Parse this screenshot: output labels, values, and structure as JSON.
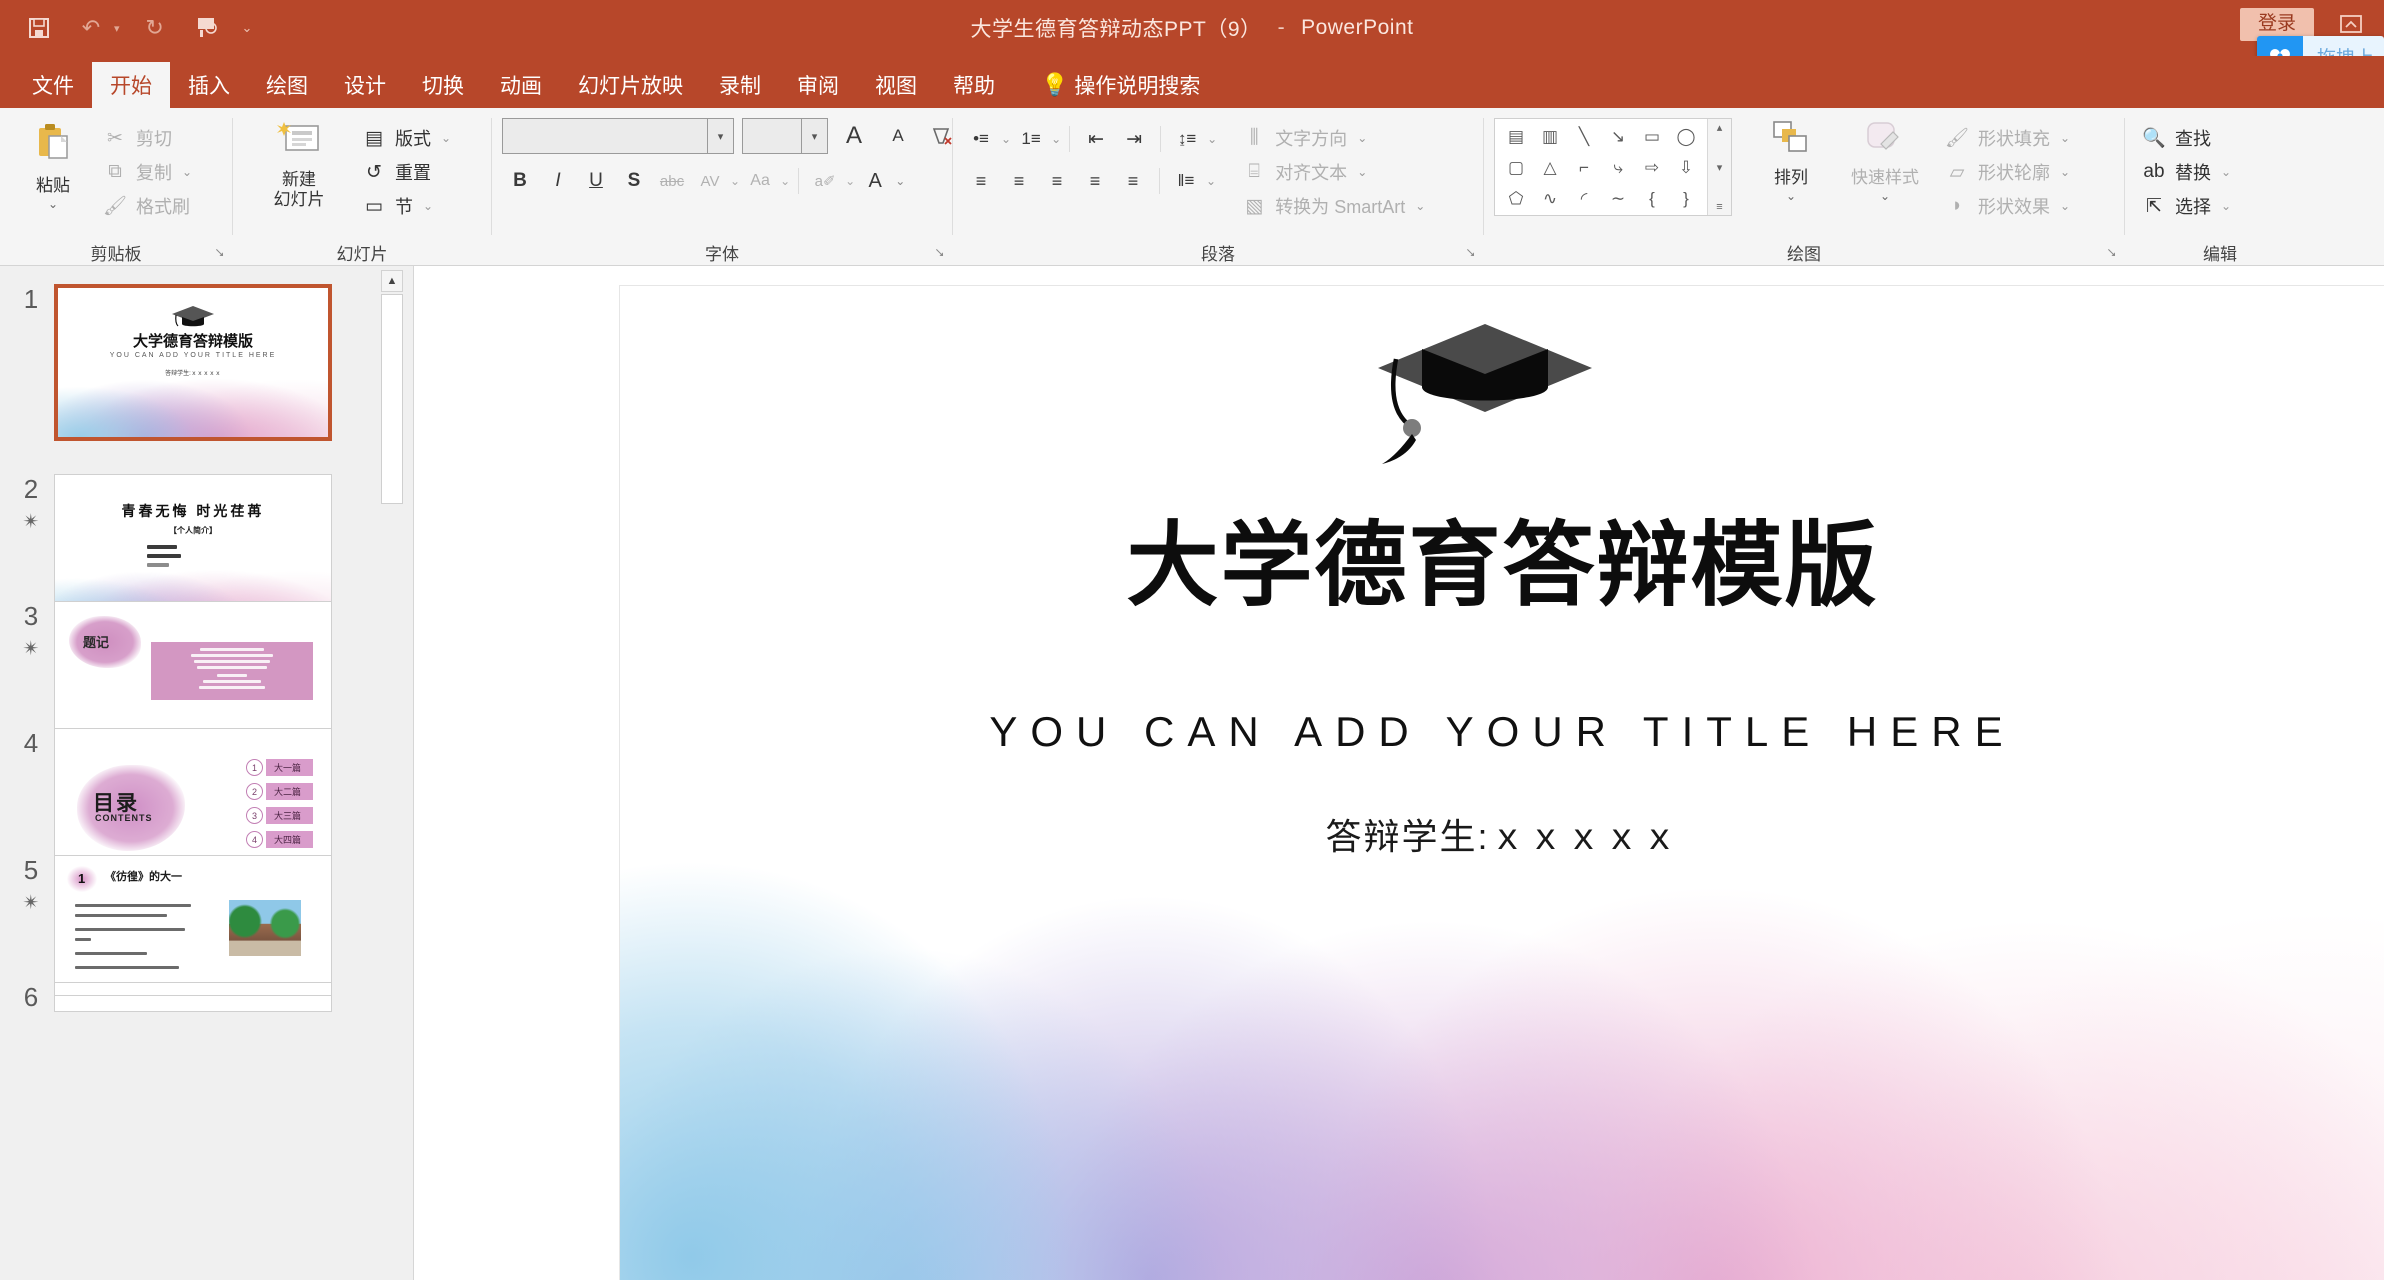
{
  "titlebar": {
    "document_title": "大学生德育答辩动态PPT（9）",
    "dash": "-",
    "app_name": "PowerPoint",
    "sign_in_label": "登录",
    "quick_access": [
      {
        "name": "save-icon",
        "glyph": "ὋE"
      },
      {
        "name": "undo-icon",
        "glyph": "↶"
      },
      {
        "name": "redo-icon",
        "glyph": "↻"
      },
      {
        "name": "start-from-beginning-icon",
        "glyph": "▤"
      },
      {
        "name": "customize-qat-icon",
        "glyph": "▾"
      }
    ],
    "ribbon_display_options_icon": "❐",
    "cloud_widget_label": "拖拽上"
  },
  "tabs": [
    {
      "label": "文件",
      "active": false
    },
    {
      "label": "开始",
      "active": true
    },
    {
      "label": "插入",
      "active": false
    },
    {
      "label": "绘图",
      "active": false
    },
    {
      "label": "设计",
      "active": false
    },
    {
      "label": "切换",
      "active": false
    },
    {
      "label": "动画",
      "active": false
    },
    {
      "label": "幻灯片放映",
      "active": false
    },
    {
      "label": "录制",
      "active": false
    },
    {
      "label": "审阅",
      "active": false
    },
    {
      "label": "视图",
      "active": false
    },
    {
      "label": "帮助",
      "active": false
    }
  ],
  "tell_me": {
    "label": "操作说明搜索",
    "icon": "lightbulb-icon"
  },
  "ribbon": {
    "clipboard": {
      "group_label": "剪贴板",
      "paste_label": "粘贴",
      "cut_label": "剪切",
      "copy_label": "复制",
      "format_painter_label": "格式刷"
    },
    "slides": {
      "group_label": "幻灯片",
      "new_slide_label": "新建\n幻灯片",
      "new_slide_line1": "新建",
      "new_slide_line2": "幻灯片",
      "layout_label": "版式",
      "reset_label": "重置",
      "section_label": "节"
    },
    "font": {
      "group_label": "字体",
      "font_name_value": "",
      "font_size_value": "",
      "increase_size_label": "A",
      "decrease_size_label": "A",
      "clear_format_label": "⌫",
      "bold_label": "B",
      "italic_label": "I",
      "underline_label": "U",
      "shadow_label": "S",
      "strikethrough_label": "abc",
      "char_spacing_label": "AV",
      "change_case_label": "Aa",
      "text_highlight_label": "a✐",
      "font_color_label": "A"
    },
    "paragraph": {
      "group_label": "段落",
      "bullets_label": "•≡",
      "numbering_label": "1≡",
      "decrease_indent_label": "⇤",
      "increase_indent_label": "⇥",
      "line_spacing_label": "↨≡",
      "align_left_label": "≡",
      "align_center_label": "≡",
      "align_right_label": "≡",
      "justify_label": "≡",
      "distribute_label": "≡",
      "columns_label": "‖≡",
      "text_direction_label": "文字方向",
      "align_text_label": "对齐文本",
      "smartart_label": "转换为 SmartArt"
    },
    "drawing": {
      "group_label": "绘图",
      "arrange_label": "排列",
      "quick_styles_label": "快速样式",
      "shape_fill_label": "形状填充",
      "shape_outline_label": "形状轮廓",
      "shape_effects_label": "形状效果",
      "shapes": [
        "Ὓ9",
        "‖A",
        "╲",
        "↘",
        "▭",
        "◯",
        "▢",
        "△",
        "┐",
        "⤷",
        "⇨",
        "⇩",
        "⬟",
        "∿",
        "◜",
        "∼",
        "{",
        "}"
      ]
    },
    "editing": {
      "group_label": "编辑",
      "find_label": "查找",
      "replace_label": "替换",
      "select_label": "选择"
    }
  },
  "slide_panel": {
    "scroll_up_icon": "▲",
    "thumbnails": [
      {
        "number": "1",
        "selected": true,
        "animated": false,
        "title": "大学德育答辩模版",
        "subtitle": "YOU CAN ADD YOUR TITLE HERE",
        "student": "答辩学生:ｘｘｘｘｘ"
      },
      {
        "number": "2",
        "selected": false,
        "animated": true,
        "title": "青春无悔 时光荏苒",
        "subtitle": "【个人简介】"
      },
      {
        "number": "3",
        "selected": false,
        "animated": true,
        "title": "题记"
      },
      {
        "number": "4",
        "selected": false,
        "animated": false,
        "title": "目录",
        "subtitle": "CONTENTS",
        "items": [
          {
            "n": "1",
            "label": "大一篇"
          },
          {
            "n": "2",
            "label": "大二篇"
          },
          {
            "n": "3",
            "label": "大三篇"
          },
          {
            "n": "4",
            "label": "大四篇"
          }
        ]
      },
      {
        "number": "5",
        "selected": false,
        "animated": true,
        "badge": "1",
        "title": "《彷徨》的大一"
      },
      {
        "number": "6",
        "selected": false,
        "animated": false
      }
    ]
  },
  "slide": {
    "title": "大学德育答辩模版",
    "subtitle": "YOU CAN ADD YOUR TITLE HERE",
    "student": "答辩学生:ｘｘｘｘｘ",
    "graduation_cap_icon": "graduation-cap-icon"
  },
  "colors": {
    "accent": "#b7472a",
    "ribbon_bg": "#f5f5f5",
    "selection_border": "#c0552f",
    "cloud_blue": "#2196f3"
  }
}
